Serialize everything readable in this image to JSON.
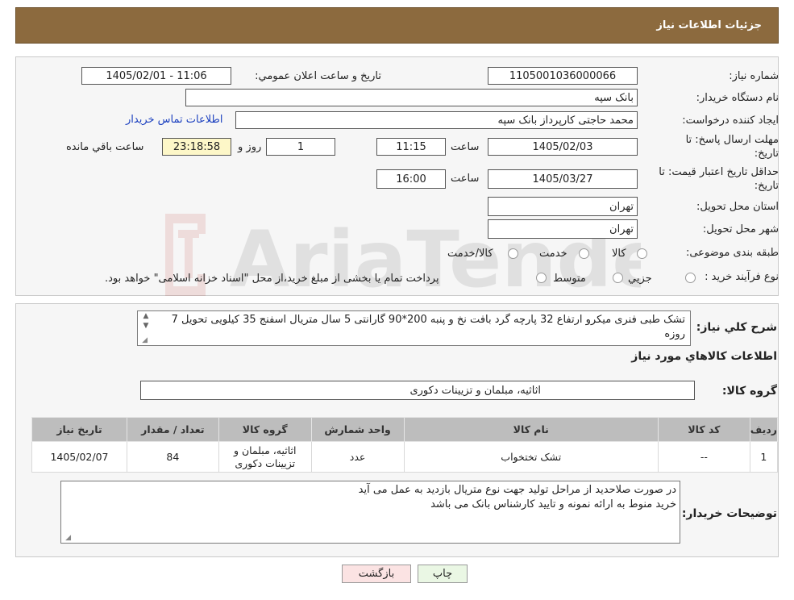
{
  "header": {
    "title": "جزئیات اطلاعات نیاز"
  },
  "fields": {
    "need_number_label": "شماره نیاز:",
    "need_number": "1105001036000066",
    "announce_label": "تاريخ و ساعت اعلان عمومي:",
    "announce_value": "1405/02/01 - 11:06",
    "buyer_org_label": "نام دستگاه خريدار:",
    "buyer_org": "بانک سپه",
    "requester_label": "ايجاد کننده درخواست:",
    "requester": "محمد حاجتی کارپرداز بانک سپه",
    "contact_link": "اطلاعات تماس خريدار",
    "deadline_label_1": "مهلت ارسال پاسخ: تا",
    "deadline_label_2": "تاريخ:",
    "deadline_date": "1405/02/03",
    "time_label": "ساعت",
    "deadline_time": "11:15",
    "days_value": "1",
    "days_label": "روز و",
    "remaining_time": "23:18:58",
    "remaining_label": "ساعت باقي مانده",
    "validity_label_1": "حداقل تاريخ اعتبار قيمت: تا",
    "validity_label_2": "تاريخ:",
    "validity_date": "1405/03/27",
    "validity_time": "16:00",
    "province_label": "استان محل تحويل:",
    "province": "تهران",
    "city_label": "شهر محل تحويل:",
    "city": "تهران",
    "category_label": "طبقه بندی موضوعی:",
    "category_options": [
      "کالا",
      "خدمت",
      "کالا/خدمت"
    ],
    "process_label": "نوع فرآيند خريد :",
    "process_options": [
      "جزيي",
      "متوسط"
    ],
    "process_note": "پرداخت تمام يا بخشی از مبلغ خريد،از محل \"اسناد خزانه اسلامی\" خواهد بود."
  },
  "description": {
    "label": "شرح کلي نياز:",
    "text": "تشک طبی فنری میکرو ارتفاع 32 پارچه گرد بافت نخ و پنبه 200*90 گارانتی 5 سال متریال اسفنج 35 کیلویی تحویل 7 روزه"
  },
  "goods": {
    "section_title": "اطلاعات کالاهاي مورد نياز",
    "group_label": "گروه کالا:",
    "group_value": "اثاثیه، مبلمان و تزيينات دکوری"
  },
  "table": {
    "headers": [
      "رديف",
      "کد کالا",
      "نام کالا",
      "واحد شمارش",
      "گروه کالا",
      "تعداد / مقدار",
      "تاريخ نياز"
    ],
    "rows": [
      {
        "row": "1",
        "code": "--",
        "name": "تشک تختخواب",
        "unit": "عدد",
        "group_line1": "اثاثیه، مبلمان و",
        "group_line2": "تزيينات دکوری",
        "qty": "84",
        "date": "1405/02/07"
      }
    ]
  },
  "buyer_notes": {
    "label": "توضيحات خريدار:",
    "line1": "در صورت صلاحدید از مراحل تولید جهت نوع متریال بازدید به عمل می آید",
    "line2": "خرید منوط به ارائه نمونه و تایید کارشناس بانک می باشد"
  },
  "buttons": {
    "print": "چاپ",
    "back": "بازگشت"
  },
  "colors": {
    "header_bg": "#8c6a3e",
    "print_btn_bg": "#eaf7e4",
    "back_btn_bg": "#fbe3e3"
  }
}
